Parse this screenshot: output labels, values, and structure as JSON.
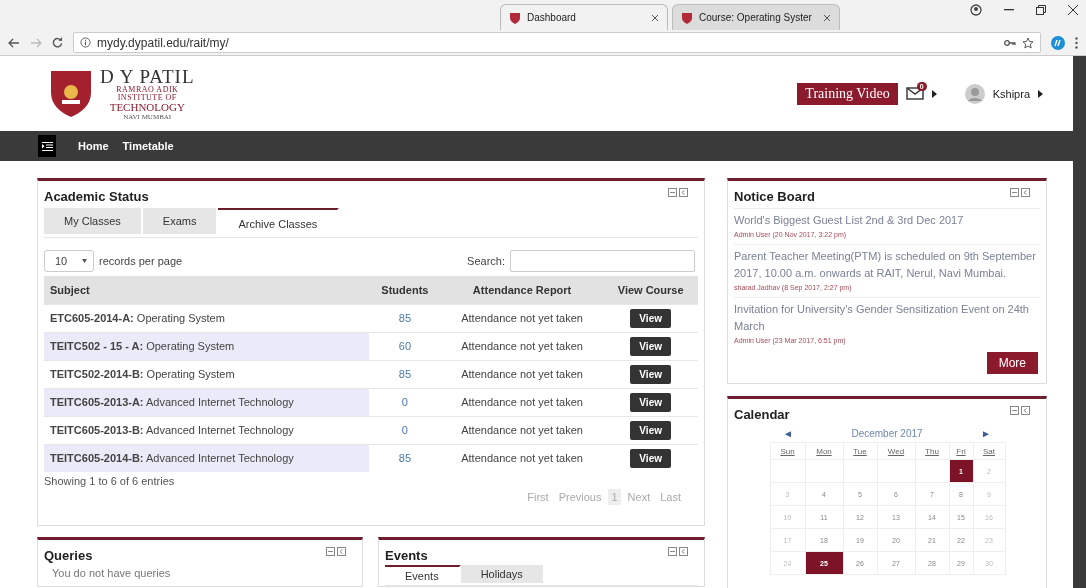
{
  "browser": {
    "tabs": [
      {
        "title": "Dashboard",
        "selected": true
      },
      {
        "title": "Course: Operating Syster",
        "selected": false
      }
    ],
    "url": "mydy.dypatil.edu/rait/my/"
  },
  "header": {
    "logo": {
      "name": "D Y PATIL",
      "line_1": "RAMRAO ADIK",
      "line_2": "INSTITUTE OF",
      "line_3": "TECHNOLOGY",
      "line_4": "NAVI MUMBAI"
    },
    "training_button": "Training Video",
    "message_count": "0",
    "user": "Kshipra"
  },
  "nav": {
    "items": [
      "Home",
      "Timetable"
    ]
  },
  "academic_status": {
    "title": "Academic Status",
    "tabs": [
      {
        "label": "My Classes",
        "selected": false
      },
      {
        "label": "Exams",
        "selected": false
      },
      {
        "label": "Archive Classes",
        "selected": true
      }
    ],
    "page_size": "10",
    "page_size_label": "records per page",
    "search_label": "Search:",
    "columns": [
      "Subject",
      "Students",
      "Attendance Report",
      "View Course"
    ],
    "rows": [
      {
        "code": "ETC605-2014-A:",
        "subject": "Operating System",
        "students": "85",
        "attendance": "Attendance not yet taken",
        "action": "View",
        "shaded": false
      },
      {
        "code": "TEITC502 - 15 - A:",
        "subject": "Operating System",
        "students": "60",
        "attendance": "Attendance not yet taken",
        "action": "View",
        "shaded": true
      },
      {
        "code": "TEITC502-2014-B:",
        "subject": "Operating System",
        "students": "85",
        "attendance": "Attendance not yet taken",
        "action": "View",
        "shaded": false
      },
      {
        "code": "TEITC605-2013-A:",
        "subject": "Advanced Internet Technology",
        "students": "0",
        "attendance": "Attendance not yet taken",
        "action": "View",
        "shaded": true
      },
      {
        "code": "TEITC605-2013-B:",
        "subject": "Advanced Internet Technology",
        "students": "0",
        "attendance": "Attendance not yet taken",
        "action": "View",
        "shaded": false
      },
      {
        "code": "TEITC605-2014-B:",
        "subject": "Advanced Internet Technology",
        "students": "85",
        "attendance": "Attendance not yet taken",
        "action": "View",
        "shaded": true
      }
    ],
    "info": "Showing 1 to 6 of 6 entries",
    "pagination": [
      {
        "label": "First",
        "selected": false
      },
      {
        "label": "Previous",
        "selected": false
      },
      {
        "label": "1",
        "selected": true
      },
      {
        "label": "Next",
        "selected": false
      },
      {
        "label": "Last",
        "selected": false
      }
    ]
  },
  "queries": {
    "title": "Queries",
    "message": "You do not have queries"
  },
  "events": {
    "title": "Events",
    "tabs": [
      {
        "label": "Events",
        "selected": true
      },
      {
        "label": "Holidays",
        "selected": false
      }
    ]
  },
  "notice_board": {
    "title": "Notice Board",
    "notices": [
      {
        "text": "World's Biggest Guest List 2nd & 3rd Dec 2017",
        "meta": "Admin User (20 Nov 2017, 3:22 pm)"
      },
      {
        "text": "Parent Teacher Meeting(PTM) is scheduled on 9th September 2017, 10.00 a.m. onwards at RAIT, Nerul, Navi Mumbai.",
        "meta": "sharad Jadhav (8 Sep 2017, 2:27 pm)"
      },
      {
        "text": "Invitation for University's Gender Sensitization Event on 24th March",
        "meta": "Admin User (23 Mar 2017, 6:51 pm)"
      }
    ],
    "more": "More"
  },
  "calendar": {
    "title": "Calendar",
    "month": "December 2017",
    "prev": "◄",
    "next": "►",
    "weekdays": [
      "Sun",
      "Mon",
      "Tue",
      "Wed",
      "Thu",
      "Fri",
      "Sat"
    ],
    "cells": [
      {
        "kind": "blank"
      },
      {
        "kind": "blank"
      },
      {
        "kind": "blank"
      },
      {
        "kind": "blank"
      },
      {
        "kind": "blank"
      },
      {
        "kind": "day",
        "day": "1",
        "marked": true
      },
      {
        "kind": "day",
        "day": "2",
        "marked": false
      },
      {
        "kind": "day",
        "day": "3",
        "marked": false
      },
      {
        "kind": "day",
        "day": "4",
        "marked": false
      },
      {
        "kind": "day",
        "day": "5",
        "marked": false
      },
      {
        "kind": "day",
        "day": "6",
        "marked": false
      },
      {
        "kind": "day",
        "day": "7",
        "marked": false
      },
      {
        "kind": "day",
        "day": "8",
        "marked": false
      },
      {
        "kind": "day",
        "day": "9",
        "marked": false
      },
      {
        "kind": "day",
        "day": "10",
        "marked": false
      },
      {
        "kind": "day",
        "day": "11",
        "marked": false
      },
      {
        "kind": "day",
        "day": "12",
        "marked": false
      },
      {
        "kind": "day",
        "day": "13",
        "marked": false
      },
      {
        "kind": "day",
        "day": "14",
        "marked": false
      },
      {
        "kind": "day",
        "day": "15",
        "marked": false
      },
      {
        "kind": "day",
        "day": "16",
        "marked": false
      },
      {
        "kind": "day",
        "day": "17",
        "marked": false
      },
      {
        "kind": "day",
        "day": "18",
        "marked": false
      },
      {
        "kind": "day",
        "day": "19",
        "marked": false
      },
      {
        "kind": "day",
        "day": "20",
        "marked": false
      },
      {
        "kind": "day",
        "day": "21",
        "marked": false
      },
      {
        "kind": "day",
        "day": "22",
        "marked": false
      },
      {
        "kind": "day",
        "day": "23",
        "marked": false
      },
      {
        "kind": "day",
        "day": "24",
        "marked": false
      },
      {
        "kind": "day",
        "day": "25",
        "marked": true
      },
      {
        "kind": "day",
        "day": "26",
        "marked": false
      },
      {
        "kind": "day",
        "day": "27",
        "marked": false
      },
      {
        "kind": "day",
        "day": "28",
        "marked": false
      },
      {
        "kind": "day",
        "day": "29",
        "marked": false
      },
      {
        "kind": "day",
        "day": "30",
        "marked": false
      }
    ]
  }
}
